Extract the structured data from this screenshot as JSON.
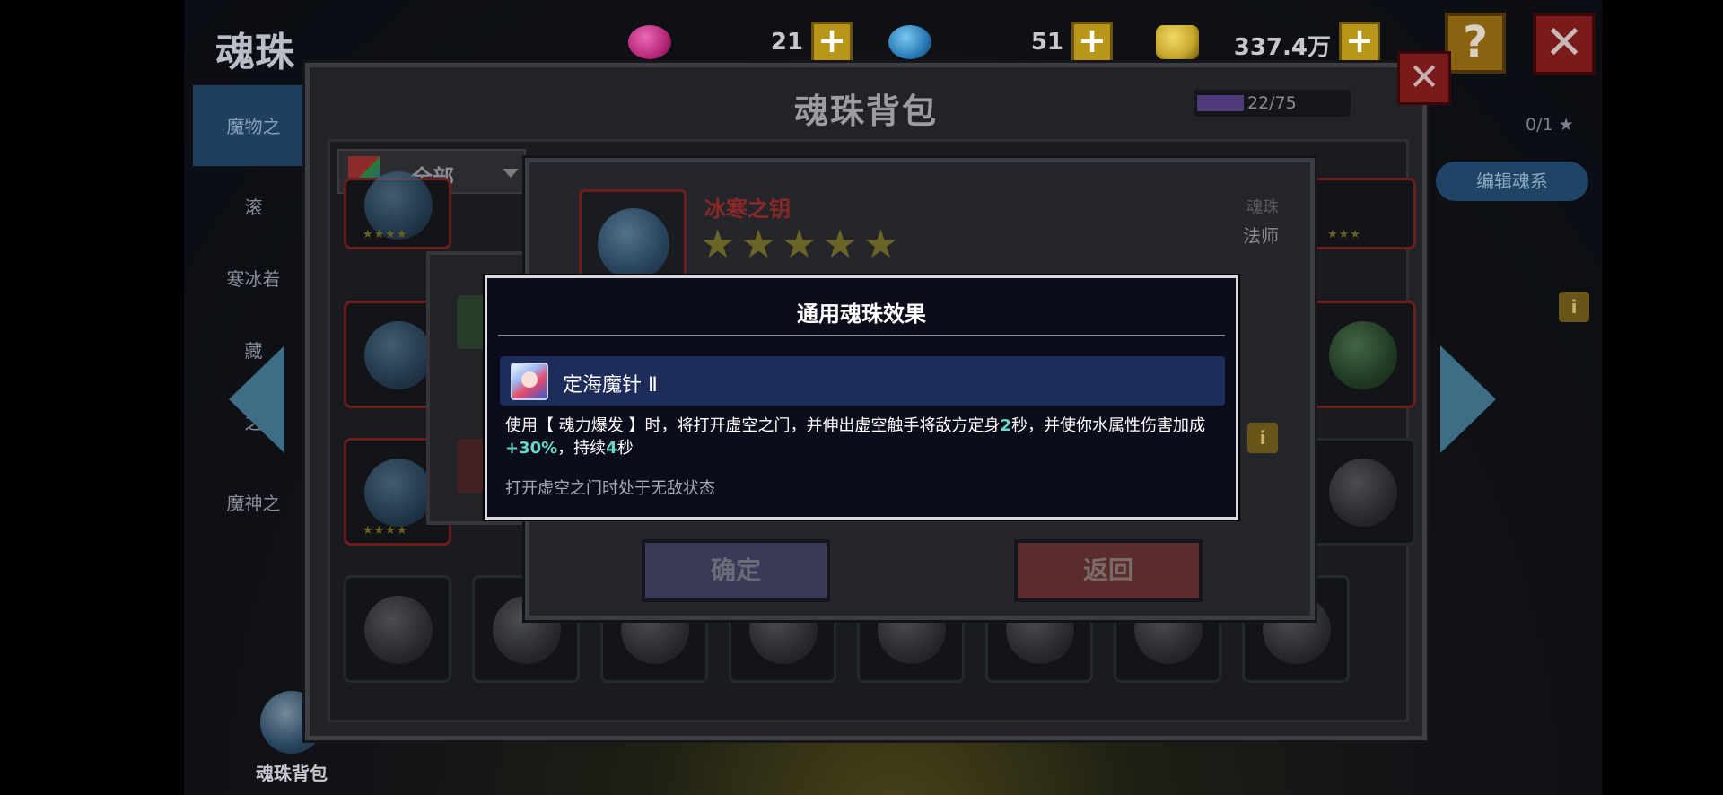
{
  "page": {
    "title": "魂珠"
  },
  "currencies": [
    {
      "name": "purple-gem",
      "amount": "21",
      "color": "#b8287a"
    },
    {
      "name": "blue-gem",
      "amount": "51",
      "color": "#2a7ab8"
    },
    {
      "name": "gold-coin",
      "amount": "337.4万",
      "color": "#c8a82a"
    }
  ],
  "top_buttons": {
    "help": "?",
    "close": "✕"
  },
  "left_tabs": [
    "魔物之",
    "滚",
    "寒冰着",
    "藏",
    "之",
    "魔神之"
  ],
  "right_panel": {
    "count": "0/1 ★",
    "edit_button": "编辑魂系"
  },
  "bottom_nav": {
    "label": "魂珠背包"
  },
  "bag": {
    "title": "魂珠背包",
    "capacity": "22/75",
    "close": "✕",
    "filter_label": "全部"
  },
  "detail": {
    "name": "冰寒之钥",
    "stars": "★★★★★",
    "type": "魂珠",
    "class": "法师",
    "confirm": "确定",
    "back": "返回"
  },
  "effect": {
    "title": "通用魂珠效果",
    "skill_name": "定海魔针 Ⅱ",
    "desc_1": "使用【 魂力爆发 】时，将打开虚空之门，并伸出虚空触手将敌方定身",
    "desc_hl_1": "2",
    "desc_2": "秒，并使你水属性伤害加成",
    "desc_hl_2": "+30%",
    "desc_3": "，持续",
    "desc_hl_3": "4",
    "desc_4": "秒",
    "note": "打开虚空之门时处于无敌状态"
  }
}
